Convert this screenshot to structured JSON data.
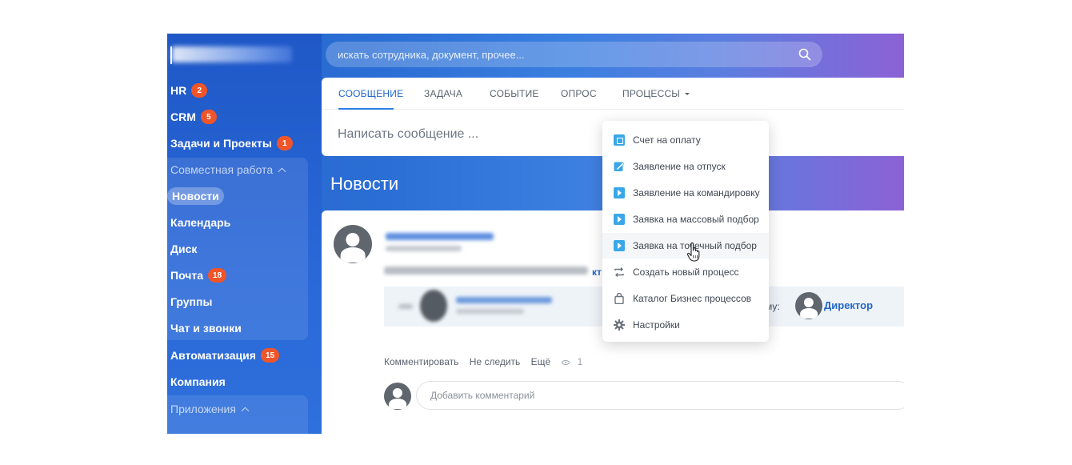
{
  "search": {
    "placeholder": "искать сотрудника, документ, прочее..."
  },
  "sidebar": {
    "items": [
      {
        "label": "HR",
        "badge": "2"
      },
      {
        "label": "CRM",
        "badge": "5"
      },
      {
        "label": "Задачи и Проекты",
        "badge": "1"
      }
    ],
    "group_collab": {
      "title": "Совместная работа",
      "items": [
        {
          "label": "Новости",
          "active": true
        },
        {
          "label": "Календарь"
        },
        {
          "label": "Диск"
        },
        {
          "label": "Почта",
          "badge": "18"
        },
        {
          "label": "Группы"
        },
        {
          "label": "Чат и звонки"
        }
      ]
    },
    "after_group": [
      {
        "label": "Автоматизация",
        "badge": "15"
      },
      {
        "label": "Компания"
      }
    ],
    "group_apps": {
      "title": "Приложения"
    }
  },
  "composer": {
    "tabs": [
      "СООБЩЕНИЕ",
      "ЗАДАЧА",
      "СОБЫТИЕ",
      "ОПРОС",
      "ПРОЦЕССЫ"
    ],
    "active_tab": "СООБЩЕНИЕ",
    "placeholder": "Написать сообщение ..."
  },
  "news": {
    "title": "Новости"
  },
  "post": {
    "link_fragment": "кт",
    "to_label": "му:",
    "recipient": "Директор",
    "actions": [
      "Комментировать",
      "Не следить",
      "Ещё"
    ],
    "views": "1",
    "comment_placeholder": "Добавить комментарий"
  },
  "processes_menu": {
    "items": [
      {
        "label": "Счет на оплату",
        "icon": "invoice-icon"
      },
      {
        "label": "Заявление на отпуск",
        "icon": "edit-icon"
      },
      {
        "label": "Заявление на командировку",
        "icon": "trip-icon"
      },
      {
        "label": "Заявка на массовый подбор",
        "icon": "mass-hire-icon"
      },
      {
        "label": "Заявка на точечный подбор",
        "icon": "point-hire-icon",
        "hover": true
      },
      {
        "label": "Создать новый процесс",
        "icon": "loop-icon"
      },
      {
        "label": "Каталог Бизнес процессов",
        "icon": "bag-icon"
      },
      {
        "label": "Настройки",
        "icon": "gear-icon"
      }
    ]
  },
  "colors": {
    "accent": "#2067c9",
    "badge": "#f0552a",
    "menu_icon": "#39a7e8"
  }
}
